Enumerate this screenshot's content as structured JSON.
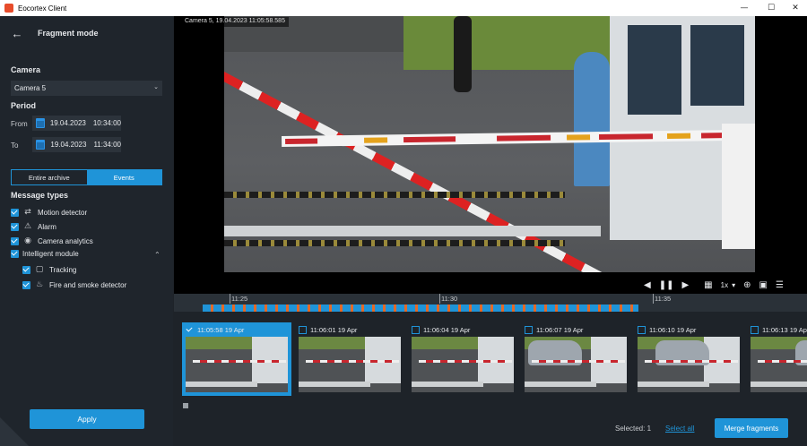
{
  "window": {
    "title": "Eocortex Client",
    "minimize_icon": "minimize-icon",
    "maximize_icon": "maximize-icon",
    "close_icon": "close-icon"
  },
  "panel": {
    "header_title": "Fragment mode",
    "camera_label": "Camera",
    "camera_value": "Camera 5",
    "period_label": "Period",
    "from_label": "From",
    "from_date": "19.04.2023",
    "from_time": "10:34:00",
    "to_label": "To",
    "to_date": "19.04.2023",
    "to_time": "11:34:00",
    "tabs": [
      {
        "label": "Entire archive",
        "active": false
      },
      {
        "label": "Events",
        "active": true
      }
    ],
    "message_types_label": "Message types",
    "message_types": [
      {
        "label": "Motion detector",
        "checked": true,
        "icon": "motion-icon"
      },
      {
        "label": "Alarm",
        "checked": true,
        "icon": "alarm-icon"
      },
      {
        "label": "Camera analytics",
        "checked": true,
        "icon": "camera-analytics-icon"
      },
      {
        "label": "Intelligent module",
        "checked": true,
        "icon": "none"
      },
      {
        "label": "Tracking",
        "checked": true,
        "icon": "tracking-icon"
      },
      {
        "label": "Fire and smoke detector",
        "checked": true,
        "icon": "fire-icon"
      }
    ],
    "apply_label": "Apply"
  },
  "video": {
    "overlay": "Camera 5, 19.04.2023 11:05:58.585",
    "speed": "1x",
    "timeline_labels": [
      "11:25",
      "11:30",
      "11:35"
    ]
  },
  "fragments": [
    {
      "label": "11:05:58 19 Apr",
      "selected": true
    },
    {
      "label": "11:06:01 19 Apr",
      "selected": false
    },
    {
      "label": "11:06:04 19 Apr",
      "selected": false
    },
    {
      "label": "11:06:07 19 Apr",
      "selected": false
    },
    {
      "label": "11:06:10 19 Apr",
      "selected": false
    },
    {
      "label": "11:06:13 19 Apr",
      "selected": false
    }
  ],
  "footer": {
    "selected_text": "Selected: 1",
    "select_all": "Select all",
    "merge_label": "Merge fragments"
  },
  "colors": {
    "accent": "#1f94d8",
    "panel_bg": "#1f252c",
    "app_bg": "#1e2329"
  }
}
